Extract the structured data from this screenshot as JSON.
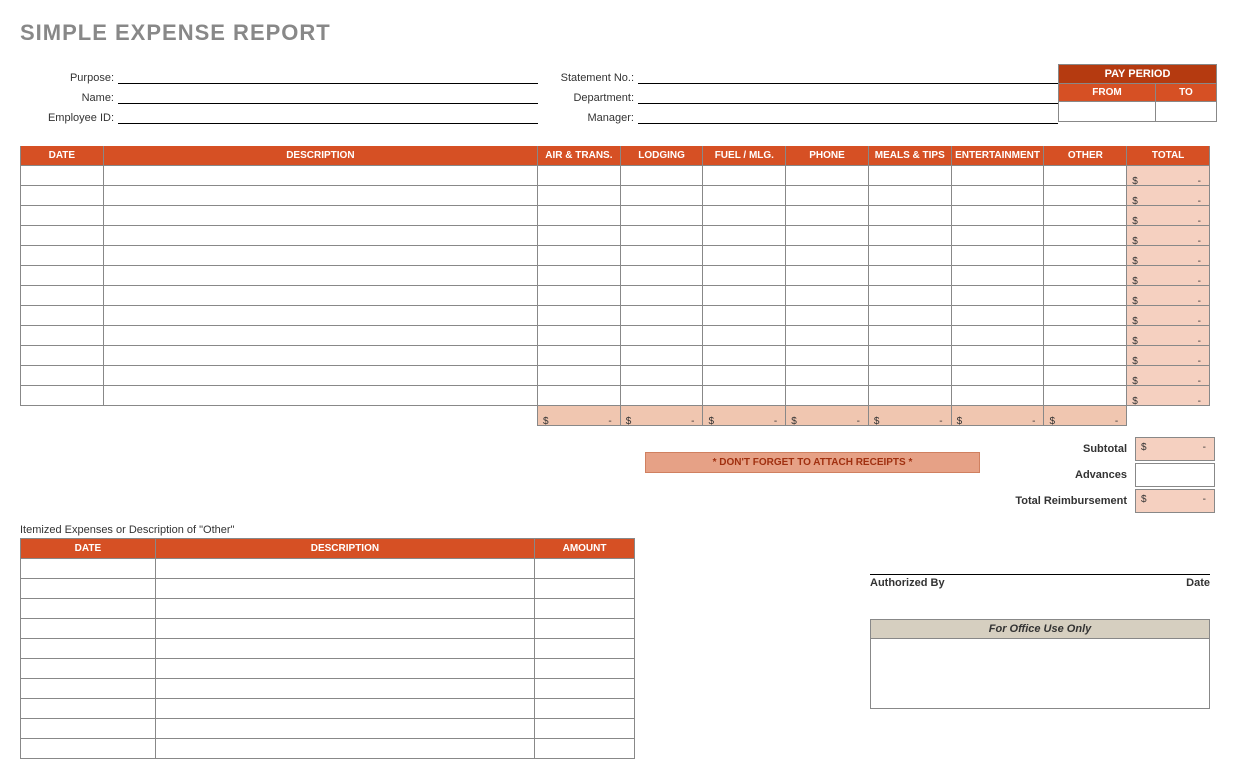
{
  "title": "SIMPLE EXPENSE REPORT",
  "meta": {
    "purpose_lbl": "Purpose:",
    "name_lbl": "Name:",
    "employee_lbl": "Employee ID:",
    "statement_lbl": "Statement No.:",
    "department_lbl": "Department:",
    "manager_lbl": "Manager:"
  },
  "payperiod": {
    "title": "PAY PERIOD",
    "from": "FROM",
    "to": "TO"
  },
  "cols": {
    "date": "DATE",
    "desc": "DESCRIPTION",
    "air": "AIR & TRANS.",
    "lodging": "LODGING",
    "fuel": "FUEL / MLG.",
    "phone": "PHONE",
    "meals": "MEALS & TIPS",
    "ent": "ENTERTAINMENT",
    "other": "OTHER",
    "total": "TOTAL"
  },
  "row_totals": [
    "$ -",
    "$ -",
    "$ -",
    "$ -",
    "$ -",
    "$ -",
    "$ -",
    "$ -",
    "$ -",
    "$ -",
    "$ -",
    "$ -"
  ],
  "col_subs": [
    "$ -",
    "$ -",
    "$ -",
    "$ -",
    "$ -",
    "$ -",
    "$ -"
  ],
  "reminder": "* DON'T FORGET TO ATTACH RECEIPTS *",
  "summary": {
    "subtotal_lbl": "Subtotal",
    "subtotal": "$ -",
    "advances_lbl": "Advances",
    "reimb_lbl": "Total Reimbursement",
    "reimb": "$ -"
  },
  "itemized": {
    "title": "Itemized Expenses or Description of \"Other\"",
    "date": "DATE",
    "desc": "DESCRIPTION",
    "amt": "AMOUNT"
  },
  "sign": {
    "auth": "Authorized By",
    "date": "Date",
    "office": "For Office Use Only"
  }
}
